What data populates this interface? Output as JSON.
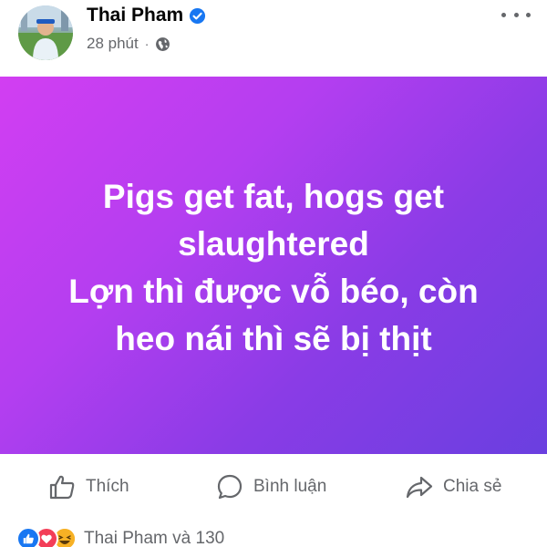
{
  "post": {
    "author": "Thai Pham",
    "time": "28 phút",
    "separator": "·",
    "verified_color": "#1877f2",
    "body_text": [
      "Pigs get fat, hogs get",
      "slaughtered",
      "Lợn thì được vỗ béo, còn",
      "heo nái thì sẽ bị thịt"
    ],
    "background_gradient": [
      "#d23ef2",
      "#6a3fe0"
    ]
  },
  "actions": {
    "like_label": "Thích",
    "comment_label": "Bình luận",
    "share_label": "Chia sẻ"
  },
  "reactions": {
    "icons": [
      "like-icon",
      "love-icon",
      "haha-icon"
    ],
    "summary": "Thai Pham và 130"
  }
}
